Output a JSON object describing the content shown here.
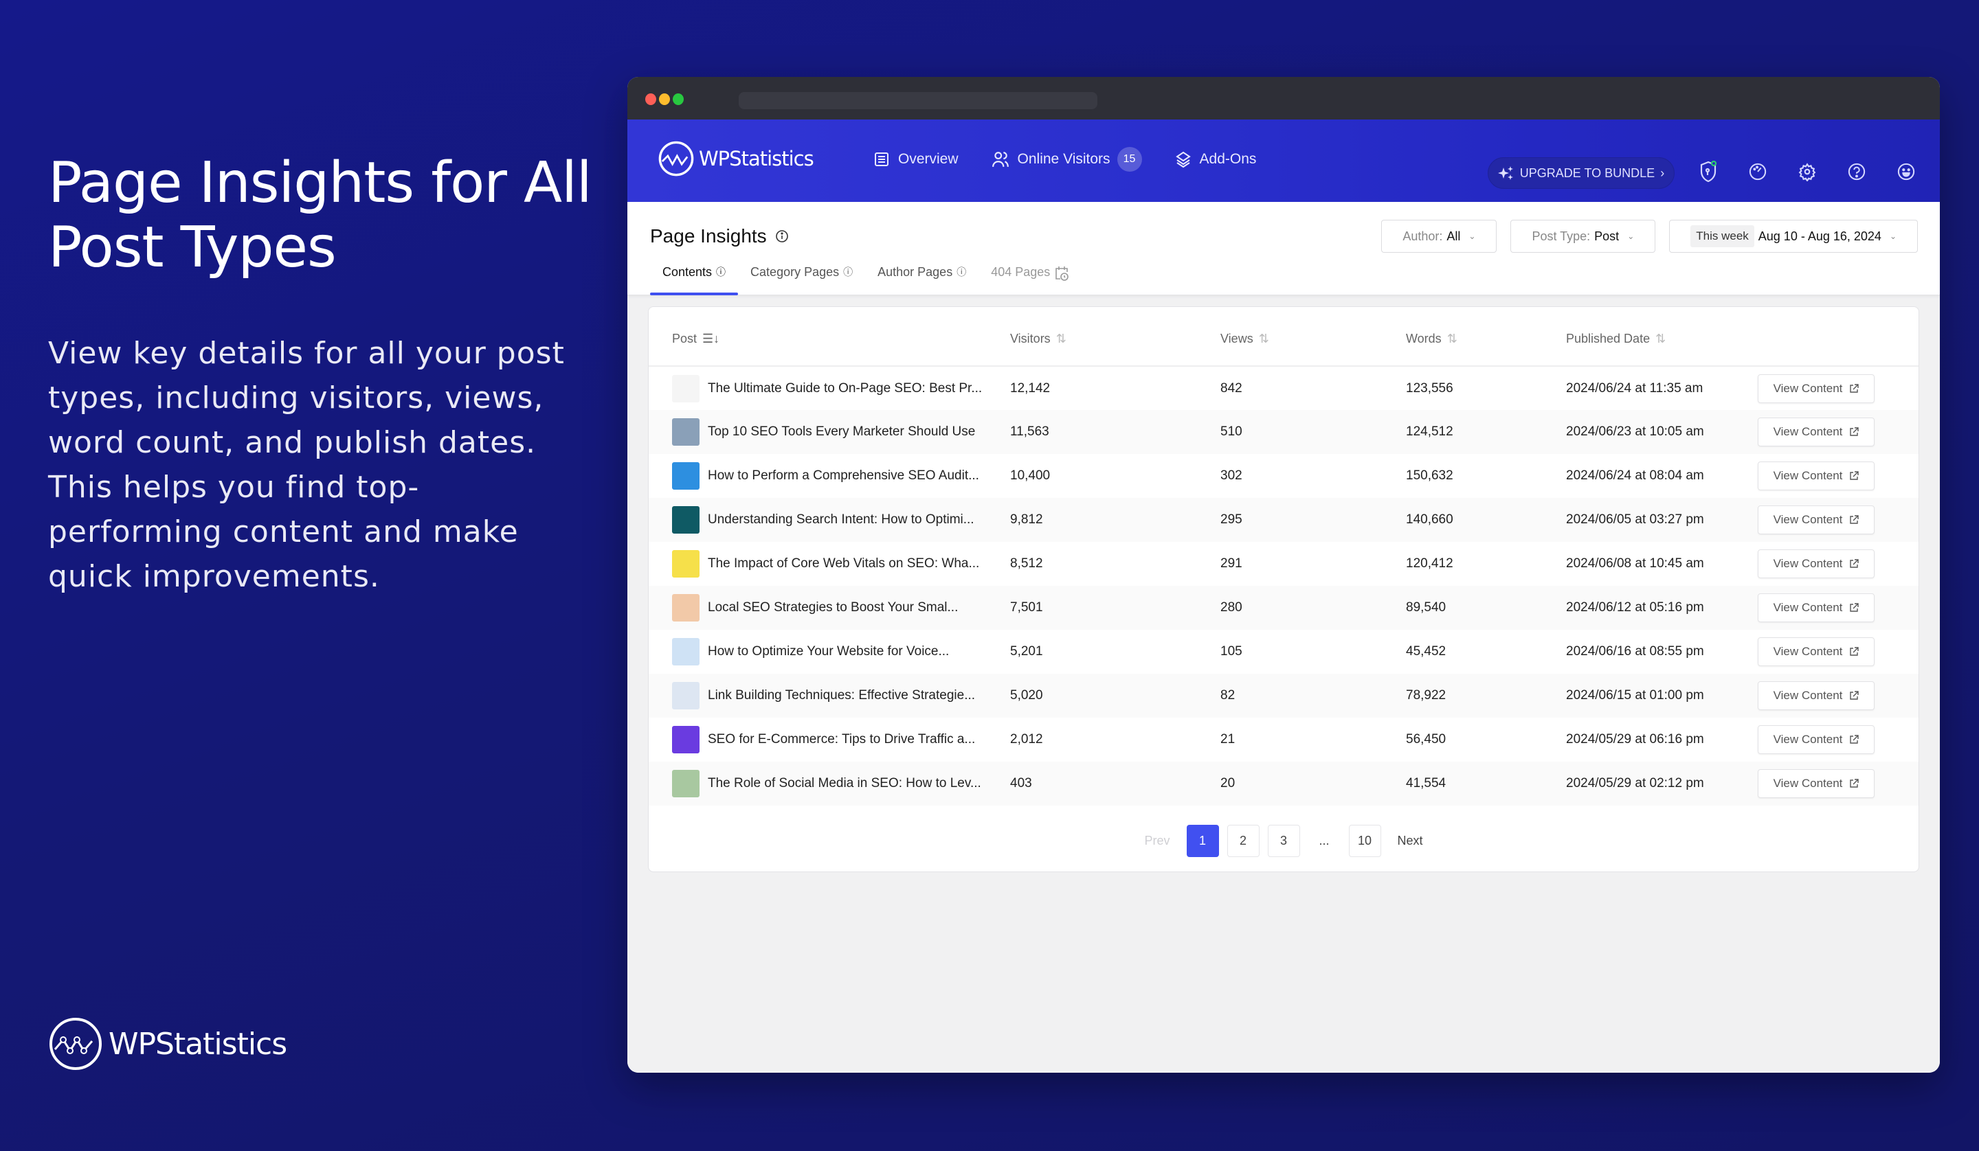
{
  "hero": {
    "title": "Page Insights for All Post Types",
    "description": "View key details for all your post types, including visitors, views, word count, and publish dates. This helps you find top-performing content and make quick improvements.",
    "brand": "WPStatistics"
  },
  "app": {
    "brand": "WPStatistics",
    "nav": [
      {
        "label": "Overview",
        "icon": "list-icon"
      },
      {
        "label": "Online Visitors",
        "icon": "users-icon",
        "badge": "15"
      },
      {
        "label": "Add-Ons",
        "icon": "layers-icon"
      }
    ],
    "upgrade_label": "UPGRADE TO BUNDLE",
    "toolbar_icons": [
      "shield-icon",
      "speedometer-icon",
      "gear-icon",
      "help-icon",
      "smiley-icon"
    ],
    "colors": {
      "accent": "#4150f0",
      "nav_bg": "#2a2fcd",
      "status_green": "#2ecc71"
    }
  },
  "page": {
    "title": "Page Insights",
    "tabs": [
      {
        "label": "Contents",
        "active": true
      },
      {
        "label": "Category Pages"
      },
      {
        "label": "Author Pages"
      },
      {
        "label": "404 Pages",
        "disabled": true
      }
    ],
    "filters": {
      "author_label": "Author:",
      "author_value": "All",
      "posttype_label": "Post Type:",
      "posttype_value": "Post",
      "date_preset": "This week",
      "date_range": "Aug 10 - Aug 16, 2024"
    }
  },
  "table": {
    "columns": [
      "Post",
      "Visitors",
      "Views",
      "Words",
      "Published Date"
    ],
    "action_label": "View Content",
    "rows": [
      {
        "title": "The Ultimate Guide to On-Page SEO: Best Pr...",
        "visitors": "12,142",
        "views": "842",
        "words": "123,556",
        "date": "2024/06/24 at 11:35 am",
        "thumb": "#f5f5f5"
      },
      {
        "title": "Top 10 SEO Tools Every Marketer Should Use",
        "visitors": "11,563",
        "views": "510",
        "words": "124,512",
        "date": "2024/06/23 at 10:05 am",
        "thumb": "#8aa0b8"
      },
      {
        "title": "How to Perform a Comprehensive SEO Audit...",
        "visitors": "10,400",
        "views": "302",
        "words": "150,632",
        "date": "2024/06/24 at 08:04 am",
        "thumb": "#2d8fe0"
      },
      {
        "title": "Understanding Search Intent: How to Optimi...",
        "visitors": "9,812",
        "views": "295",
        "words": "140,660",
        "date": "2024/06/05 at 03:27 pm",
        "thumb": "#0f5a64"
      },
      {
        "title": "The Impact of Core Web Vitals on SEO: Wha...",
        "visitors": "8,512",
        "views": "291",
        "words": "120,412",
        "date": "2024/06/08 at 10:45 am",
        "thumb": "#f6e04a"
      },
      {
        "title": "Local SEO Strategies to Boost Your Smal...",
        "visitors": "7,501",
        "views": "280",
        "words": "89,540",
        "date": "2024/06/12 at 05:16 pm",
        "thumb": "#f2c9a8"
      },
      {
        "title": "How to Optimize Your Website for Voice...",
        "visitors": "5,201",
        "views": "105",
        "words": "45,452",
        "date": "2024/06/16 at 08:55 pm",
        "thumb": "#cfe2f5"
      },
      {
        "title": "Link Building Techniques: Effective Strategie...",
        "visitors": "5,020",
        "views": "82",
        "words": "78,922",
        "date": "2024/06/15 at 01:00 pm",
        "thumb": "#dde6f2"
      },
      {
        "title": "SEO for E-Commerce: Tips to Drive Traffic a...",
        "visitors": "2,012",
        "views": "21",
        "words": "56,450",
        "date": "2024/05/29 at 06:16 pm",
        "thumb": "#6a3be0"
      },
      {
        "title": "The Role of Social Media in SEO: How to Lev...",
        "visitors": "403",
        "views": "20",
        "words": "41,554",
        "date": "2024/05/29 at 02:12 pm",
        "thumb": "#a8c8a0"
      }
    ]
  },
  "pagination": {
    "prev": "Prev",
    "next": "Next",
    "pages": [
      "1",
      "2",
      "3"
    ],
    "ellipsis": "...",
    "last": "10",
    "current": "1"
  }
}
